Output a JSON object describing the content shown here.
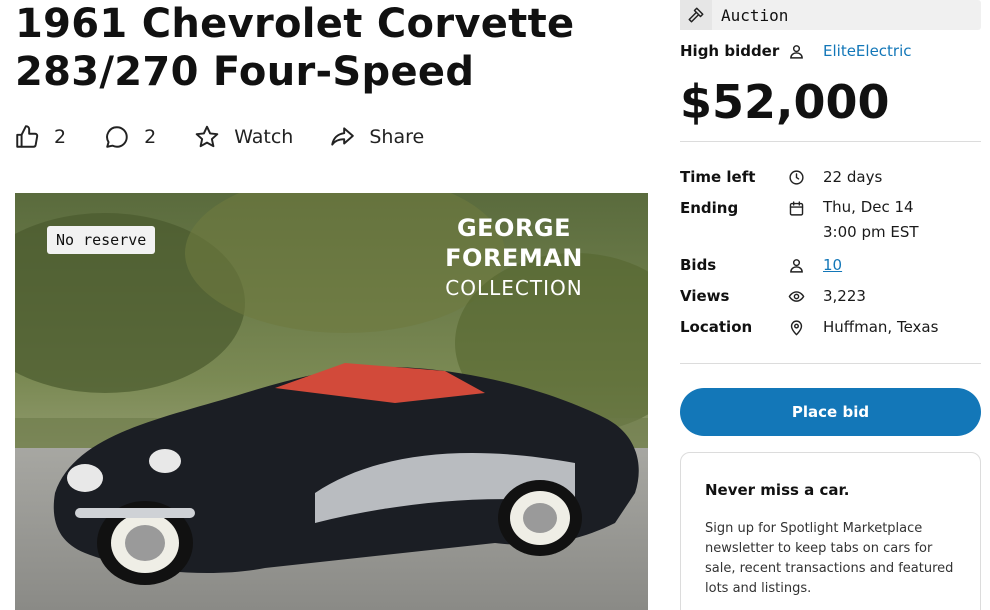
{
  "listing": {
    "title": "1961 Chevrolet Corvette 283/270 Four-Speed"
  },
  "actions": {
    "likes": "2",
    "comments": "2",
    "watch": "Watch",
    "share": "Share"
  },
  "photo": {
    "badge": "No reserve",
    "collection_line1": "GEORGE FOREMAN",
    "collection_line2": "COLLECTION"
  },
  "sidebar": {
    "auction_label": "Auction",
    "high_bidder_label": "High bidder",
    "high_bidder": "EliteElectric",
    "price": "$52,000",
    "stats": {
      "time_left_label": "Time left",
      "time_left": "22 days",
      "ending_label": "Ending",
      "ending_date": "Thu, Dec 14",
      "ending_time": "3:00 pm EST",
      "bids_label": "Bids",
      "bids": "10",
      "views_label": "Views",
      "views": "3,223",
      "location_label": "Location",
      "location": "Huffman, Texas"
    },
    "place_bid": "Place bid",
    "newsletter": {
      "heading": "Never miss a car.",
      "body": "Sign up for Spotlight Marketplace newsletter to keep tabs on cars for sale, recent transactions and featured lots and listings."
    }
  },
  "colors": {
    "accent": "#1377b8",
    "text": "#111111",
    "divider": "#dcdcdc"
  }
}
